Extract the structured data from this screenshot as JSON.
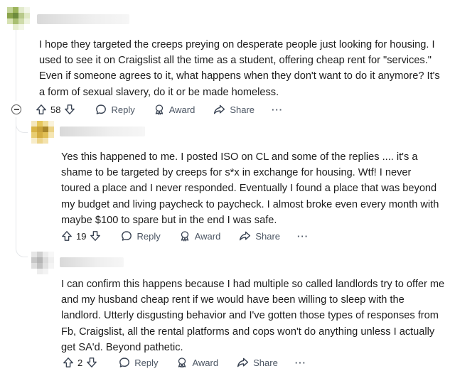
{
  "comments": [
    {
      "text": "I hope they targeted the creeps preying on desperate people just looking for housing. I used to see it on Craigslist all the time as a student, offering cheap rent for \"services.\" Even if someone agrees to it, what happens when they don't want to do it anymore? It's a form of sexual slavery, do it or be made homeless.",
      "votes": "58",
      "reply_label": "Reply",
      "award_label": "Award",
      "share_label": "Share",
      "more_label": "···"
    },
    {
      "text": "Yes this happened to me. I posted ISO on CL and some of the replies .... it's a shame to be targeted by creeps for s*x in exchange for housing. Wtf! I never toured a place and I never responded. Eventually I found a place that was beyond my budget and living paycheck to paycheck. I almost broke even every month with maybe $100 to spare but in the end I was safe.",
      "votes": "19",
      "reply_label": "Reply",
      "award_label": "Award",
      "share_label": "Share",
      "more_label": "···"
    },
    {
      "text": "I can confirm this happens because I had multiple so called landlords try to offer me and my husband cheap rent if we would have been willing to sleep with the landlord. Utterly disgusting behavior and I've gotten those types of responses from Fb, Craigslist, all the rental platforms and cops won't do anything unless I actually get SA'd. Beyond pathetic.",
      "votes": "2",
      "reply_label": "Reply",
      "award_label": "Award",
      "share_label": "Share",
      "more_label": "···"
    }
  ],
  "colors": {
    "avatar1": [
      "#6e8b3d",
      "#b8c98a",
      "#9bb35a",
      "#dfe8c4"
    ],
    "avatar2": [
      "#c9a23a",
      "#e5c65c",
      "#a8862a",
      "#f0dc95"
    ],
    "avatar3": [
      "#c7c7c7",
      "#e2e2e2",
      "#b5b5b5",
      "#efefef"
    ]
  },
  "icons": [
    "upvote-icon",
    "downvote-icon",
    "reply-bubble-icon",
    "award-icon",
    "share-arrow-icon",
    "more-icon",
    "collapse-icon"
  ]
}
